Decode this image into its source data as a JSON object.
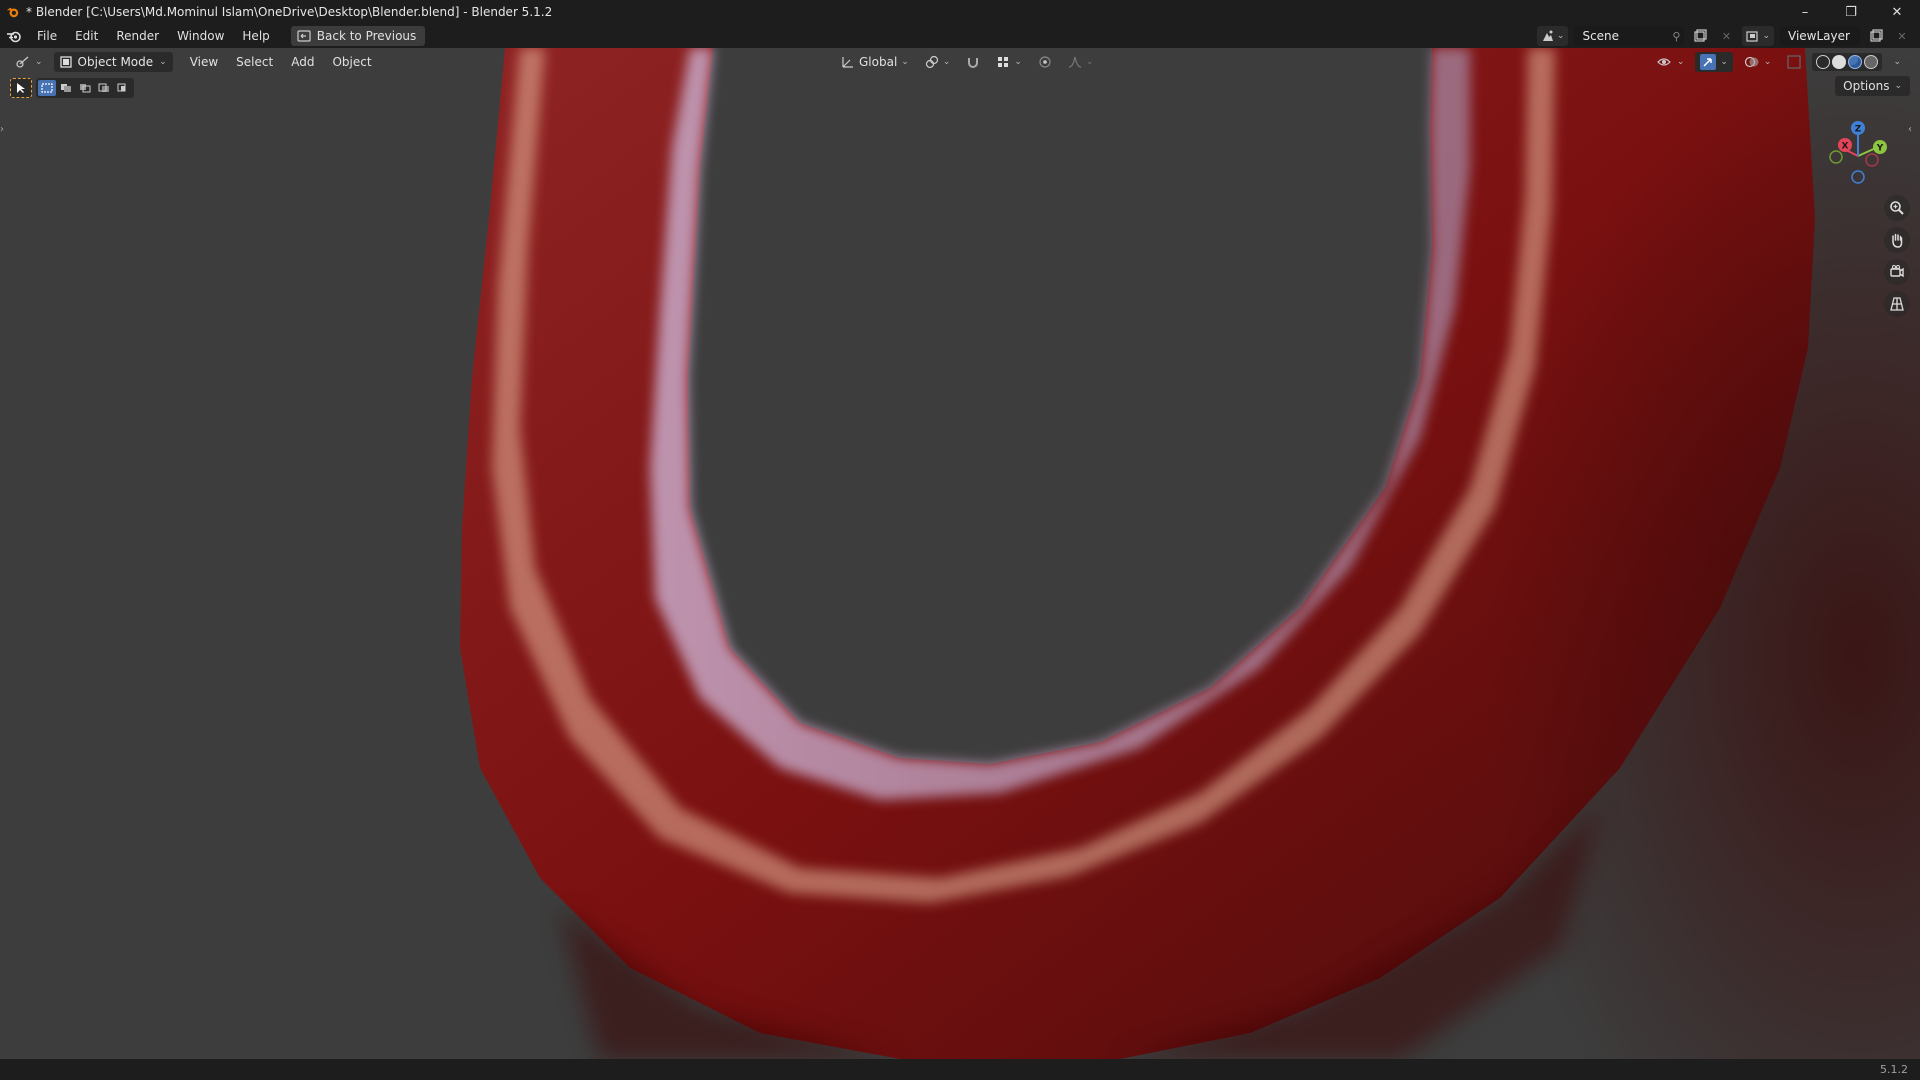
{
  "window": {
    "title": "* Blender [C:\\Users\\Md.Mominul Islam\\OneDrive\\Desktop\\Blender.blend] - Blender 5.1.2",
    "minimize": "–",
    "maximize": "❐",
    "close": "✕"
  },
  "menubar": {
    "items": [
      "File",
      "Edit",
      "Render",
      "Window",
      "Help"
    ],
    "back_button": "Back to Previous",
    "scene": "Scene",
    "view_layer": "ViewLayer"
  },
  "viewport": {
    "mode": "Object Mode",
    "menus": [
      "View",
      "Select",
      "Add",
      "Object"
    ],
    "transform_orientation": "Global",
    "options": "Options",
    "gizmo_axes": [
      "X",
      "Y",
      "Z"
    ]
  },
  "colors": {
    "accent": "#4772b3",
    "axis_x": "#e64459",
    "axis_y": "#8cc63f",
    "axis_z": "#3f80d8",
    "object_red": "#8a1414"
  },
  "statusbar": {
    "version": "5.1.2"
  }
}
